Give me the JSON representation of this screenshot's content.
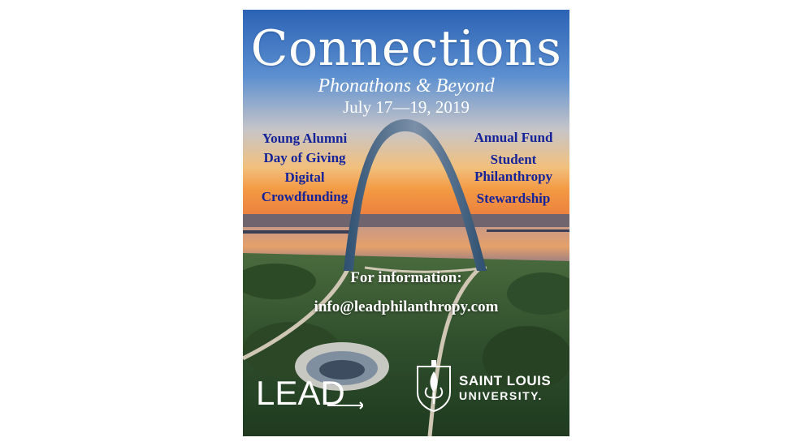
{
  "poster": {
    "title": "Connections",
    "subtitle": "Phonathons & Beyond",
    "dates": "July 17—19, 2019",
    "topics_left": [
      "Young Alumni",
      "Day of Giving",
      "Digital",
      "Crowdfunding"
    ],
    "topics_right": [
      "Annual Fund",
      "Student",
      "Philanthropy",
      "Stewardship"
    ],
    "info_label": "For information:",
    "info_email": "info@leadphilanthropy.com"
  },
  "logos": {
    "lead": "LEAD",
    "slu_line1": "SAINT LOUIS",
    "slu_line2": "UNIVERSITY."
  },
  "colors": {
    "topic_text": "#15239a",
    "sky_top": "#2f67b8",
    "horizon": "#f2a24e"
  }
}
